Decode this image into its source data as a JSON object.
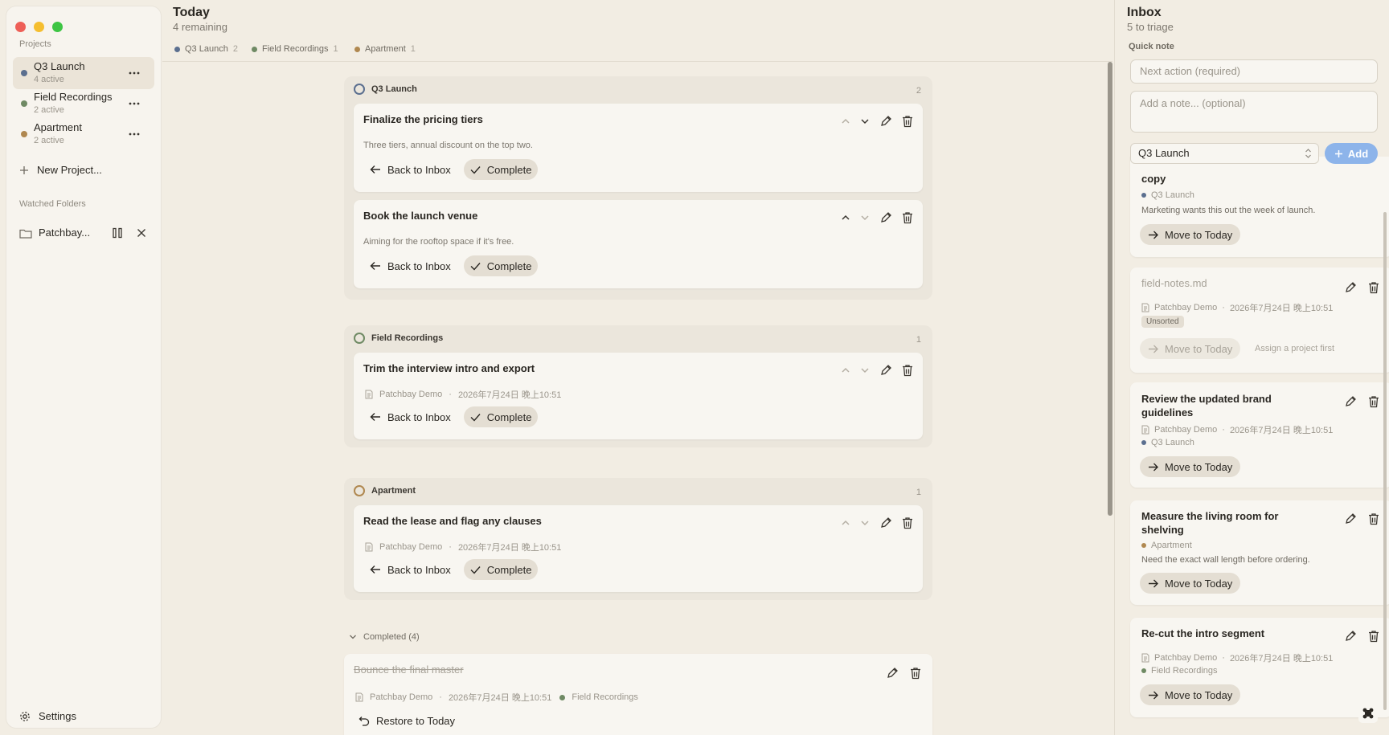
{
  "sidebar": {
    "projects_label": "Projects",
    "projects": [
      {
        "name": "Q3 Launch",
        "count": "4 active",
        "color": "#5b6f8f"
      },
      {
        "name": "Field Recordings",
        "count": "2 active",
        "color": "#6f8a64"
      },
      {
        "name": "Apartment",
        "count": "2 active",
        "color": "#b08850"
      }
    ],
    "new_project": "New Project...",
    "watched_label": "Watched Folders",
    "folder_name": "Patchbay...",
    "settings": "Settings"
  },
  "today": {
    "title": "Today",
    "remaining": "4 remaining",
    "chips": [
      {
        "name": "Q3 Launch",
        "count": "2",
        "color": "#5b6f8f"
      },
      {
        "name": "Field Recordings",
        "count": "1",
        "color": "#6f8a64"
      },
      {
        "name": "Apartment",
        "count": "1",
        "color": "#b08850"
      }
    ],
    "groups": {
      "q3": {
        "name": "Q3 Launch",
        "count": "2"
      },
      "field": {
        "name": "Field Recordings",
        "count": "1"
      },
      "apt": {
        "name": "Apartment",
        "count": "1"
      }
    },
    "tasks": {
      "pricing": {
        "title": "Finalize the pricing tiers",
        "note": "Three tiers, annual discount on the top two."
      },
      "venue": {
        "title": "Book the launch venue",
        "note": "Aiming for the rooftop space if it's free."
      },
      "trim": {
        "title": "Trim the interview intro and export",
        "source": "Patchbay Demo",
        "time": "2026年7月24日 晚上10:51"
      },
      "lease": {
        "title": "Read the lease and flag any clauses",
        "source": "Patchbay Demo",
        "time": "2026年7月24日 晚上10:51"
      }
    },
    "back_label": "Back to Inbox",
    "complete_label": "Complete",
    "completed_label": "Completed (4)",
    "completed_item": {
      "title": "Bounce the final master",
      "source": "Patchbay Demo",
      "time": "2026年7月24日 晚上10:51",
      "project": "Field Recordings"
    },
    "restore_label": "Restore to Today"
  },
  "inbox": {
    "title": "Inbox",
    "subtitle": "5 to triage",
    "quick_note_label": "Quick note",
    "next_placeholder": "Next action (required)",
    "note_placeholder": "Add a note... (optional)",
    "project_select": "Q3 Launch",
    "add_label": "Add",
    "move_label": "Move to Today",
    "items": {
      "copy": {
        "title": "copy",
        "project": "Q3 Launch",
        "note": "Marketing wants this out the week of launch."
      },
      "field_notes": {
        "title": "field-notes.md",
        "source": "Patchbay Demo",
        "time": "2026年7月24日 晚上10:51",
        "badge": "Unsorted",
        "hint": "Assign a project first"
      },
      "brand": {
        "title": "Review the updated brand guidelines",
        "source": "Patchbay Demo",
        "time": "2026年7月24日 晚上10:51",
        "project": "Q3 Launch"
      },
      "measure": {
        "title": "Measure the living room for shelving",
        "project": "Apartment",
        "note": "Need the exact wall length before ordering."
      },
      "recut": {
        "title": "Re-cut the intro segment",
        "source": "Patchbay Demo",
        "time": "2026年7月24日 晚上10:51",
        "project": "Field Recordings"
      }
    }
  },
  "colors": {
    "q3": "#5b6f8f",
    "field": "#6f8a64",
    "apt": "#b08850",
    "accent": "#8db4ea"
  }
}
